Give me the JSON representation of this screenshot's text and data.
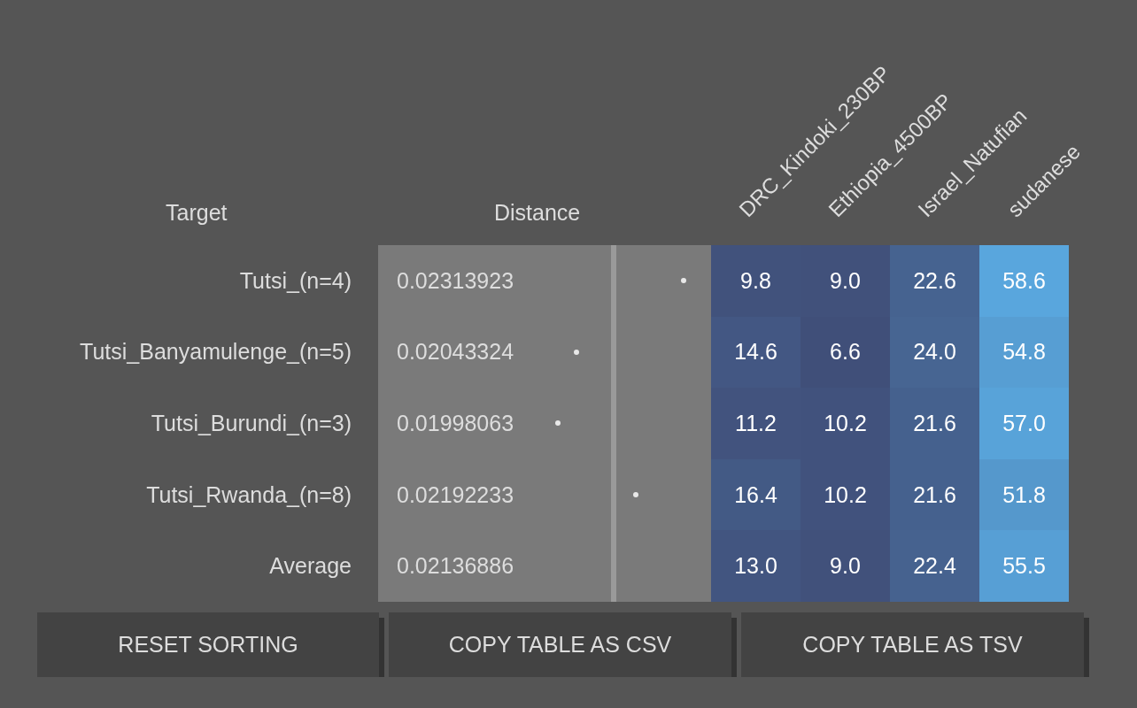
{
  "table": {
    "columns": [
      {
        "label": "Target"
      },
      {
        "label": "Distance"
      },
      {
        "label": "DRC_Kindoki_230BP"
      },
      {
        "label": "Ethiopia_4500BP"
      },
      {
        "label": "Israel_Natufian"
      },
      {
        "label": "sudanese"
      }
    ],
    "rows": [
      {
        "target": "Tutsi_(n=4)",
        "distance": "0.02313923",
        "level": 0.918,
        "values": [
          "9.8",
          "9.0",
          "22.6",
          "58.6"
        ]
      },
      {
        "target": "Tutsi_Banyamulenge_(n=5)",
        "distance": "0.02043324",
        "level": 0.596,
        "values": [
          "14.6",
          "6.6",
          "24.0",
          "54.8"
        ]
      },
      {
        "target": "Tutsi_Burundi_(n=3)",
        "distance": "0.01998063",
        "level": 0.54,
        "values": [
          "11.2",
          "10.2",
          "21.6",
          "57.0"
        ]
      },
      {
        "target": "Tutsi_Rwanda_(n=8)",
        "distance": "0.02192233",
        "level": 0.774,
        "values": [
          "16.4",
          "10.2",
          "21.6",
          "51.8"
        ]
      },
      {
        "target": "Average",
        "distance": "0.02136886",
        "level": 0.708,
        "values": [
          "13.0",
          "9.0",
          "22.4",
          "55.5"
        ]
      }
    ]
  },
  "buttons": [
    "RESET SORTING",
    "COPY TABLE AS CSV",
    "COPY TABLE AS TSV"
  ]
}
